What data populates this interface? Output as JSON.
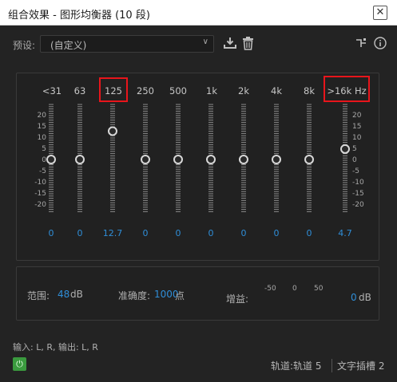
{
  "window": {
    "title": "组合效果 - 图形均衡器 (10 段)",
    "close_glyph": "✕"
  },
  "preset": {
    "label": "预设:",
    "value": "(自定义)"
  },
  "bands": [
    {
      "label": "<31",
      "value": "0"
    },
    {
      "label": "63",
      "value": "0"
    },
    {
      "label": "125",
      "value": "12.7"
    },
    {
      "label": "250",
      "value": "0"
    },
    {
      "label": "500",
      "value": "0"
    },
    {
      "label": "1k",
      "value": "0"
    },
    {
      "label": "2k",
      "value": "0"
    },
    {
      "label": "4k",
      "value": "0"
    },
    {
      "label": "8k",
      "value": "0"
    },
    {
      "label": ">16k Hz",
      "value": "4.7"
    }
  ],
  "band_levels_db": [
    0,
    0,
    12.7,
    0,
    0,
    0,
    0,
    0,
    0,
    4.7
  ],
  "highlighted_bands": [
    "125",
    ">16k Hz"
  ],
  "scale_ticks": [
    "20",
    "15",
    "10",
    "5",
    "0",
    "-5",
    "-10",
    "-15",
    "-20"
  ],
  "range": {
    "label": "范围:",
    "value": "48",
    "unit": "dB"
  },
  "accuracy": {
    "label": "准确度:",
    "value": "1000",
    "unit": "点"
  },
  "gain": {
    "label": "增益:",
    "ticks": [
      "-50",
      "0",
      "50"
    ],
    "value": "0",
    "unit": "dB",
    "level_db": 0
  },
  "footer": {
    "io": "输入: L, R,  输出: L, R",
    "track": "轨道:轨道 5",
    "slot": "文字插槽 2"
  },
  "colors": {
    "accent": "#2f8ed8",
    "highlight": "#e8151b",
    "power": "#3a9a3e"
  },
  "icons": [
    "save-preset-icon",
    "trash-icon",
    "routing-icon",
    "info-icon",
    "power-icon",
    "chevron-down-icon",
    "close-icon"
  ]
}
